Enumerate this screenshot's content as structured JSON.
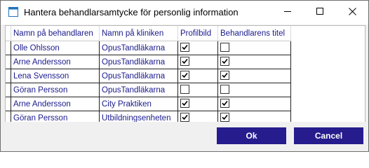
{
  "window": {
    "title": "Hantera behandlarsamtycke för personlig information",
    "controls": {
      "minimize": "minimize",
      "maximize": "maximize",
      "close": "close"
    }
  },
  "table": {
    "columns": [
      "Namn på behandlaren",
      "Namn på kliniken",
      "Profilbild",
      "Behandlarens titel"
    ],
    "rows": [
      {
        "name": "Olle Ohlsson",
        "clinic": "OpusTandläkarna",
        "profile": true,
        "title": false
      },
      {
        "name": "Arne Andersson",
        "clinic": "OpusTandläkarna",
        "profile": true,
        "title": true
      },
      {
        "name": "Lena Svensson",
        "clinic": "OpusTandläkarna",
        "profile": true,
        "title": true
      },
      {
        "name": "Göran Persson",
        "clinic": "OpusTandläkarna",
        "profile": false,
        "title": false
      },
      {
        "name": "Arne Andersson",
        "clinic": "City Praktiken",
        "profile": true,
        "title": true
      },
      {
        "name": "Göran Persson",
        "clinic": "Utbildningsenheten",
        "profile": true,
        "title": true
      }
    ]
  },
  "buttons": {
    "ok": "Ok",
    "cancel": "Cancel"
  },
  "colors": {
    "button_bg": "#261c8d",
    "header_text": "#1a1a8c",
    "cell_text": "#1a1a8c"
  },
  "icons": {
    "app": "app-window-icon",
    "check": "check-icon"
  }
}
